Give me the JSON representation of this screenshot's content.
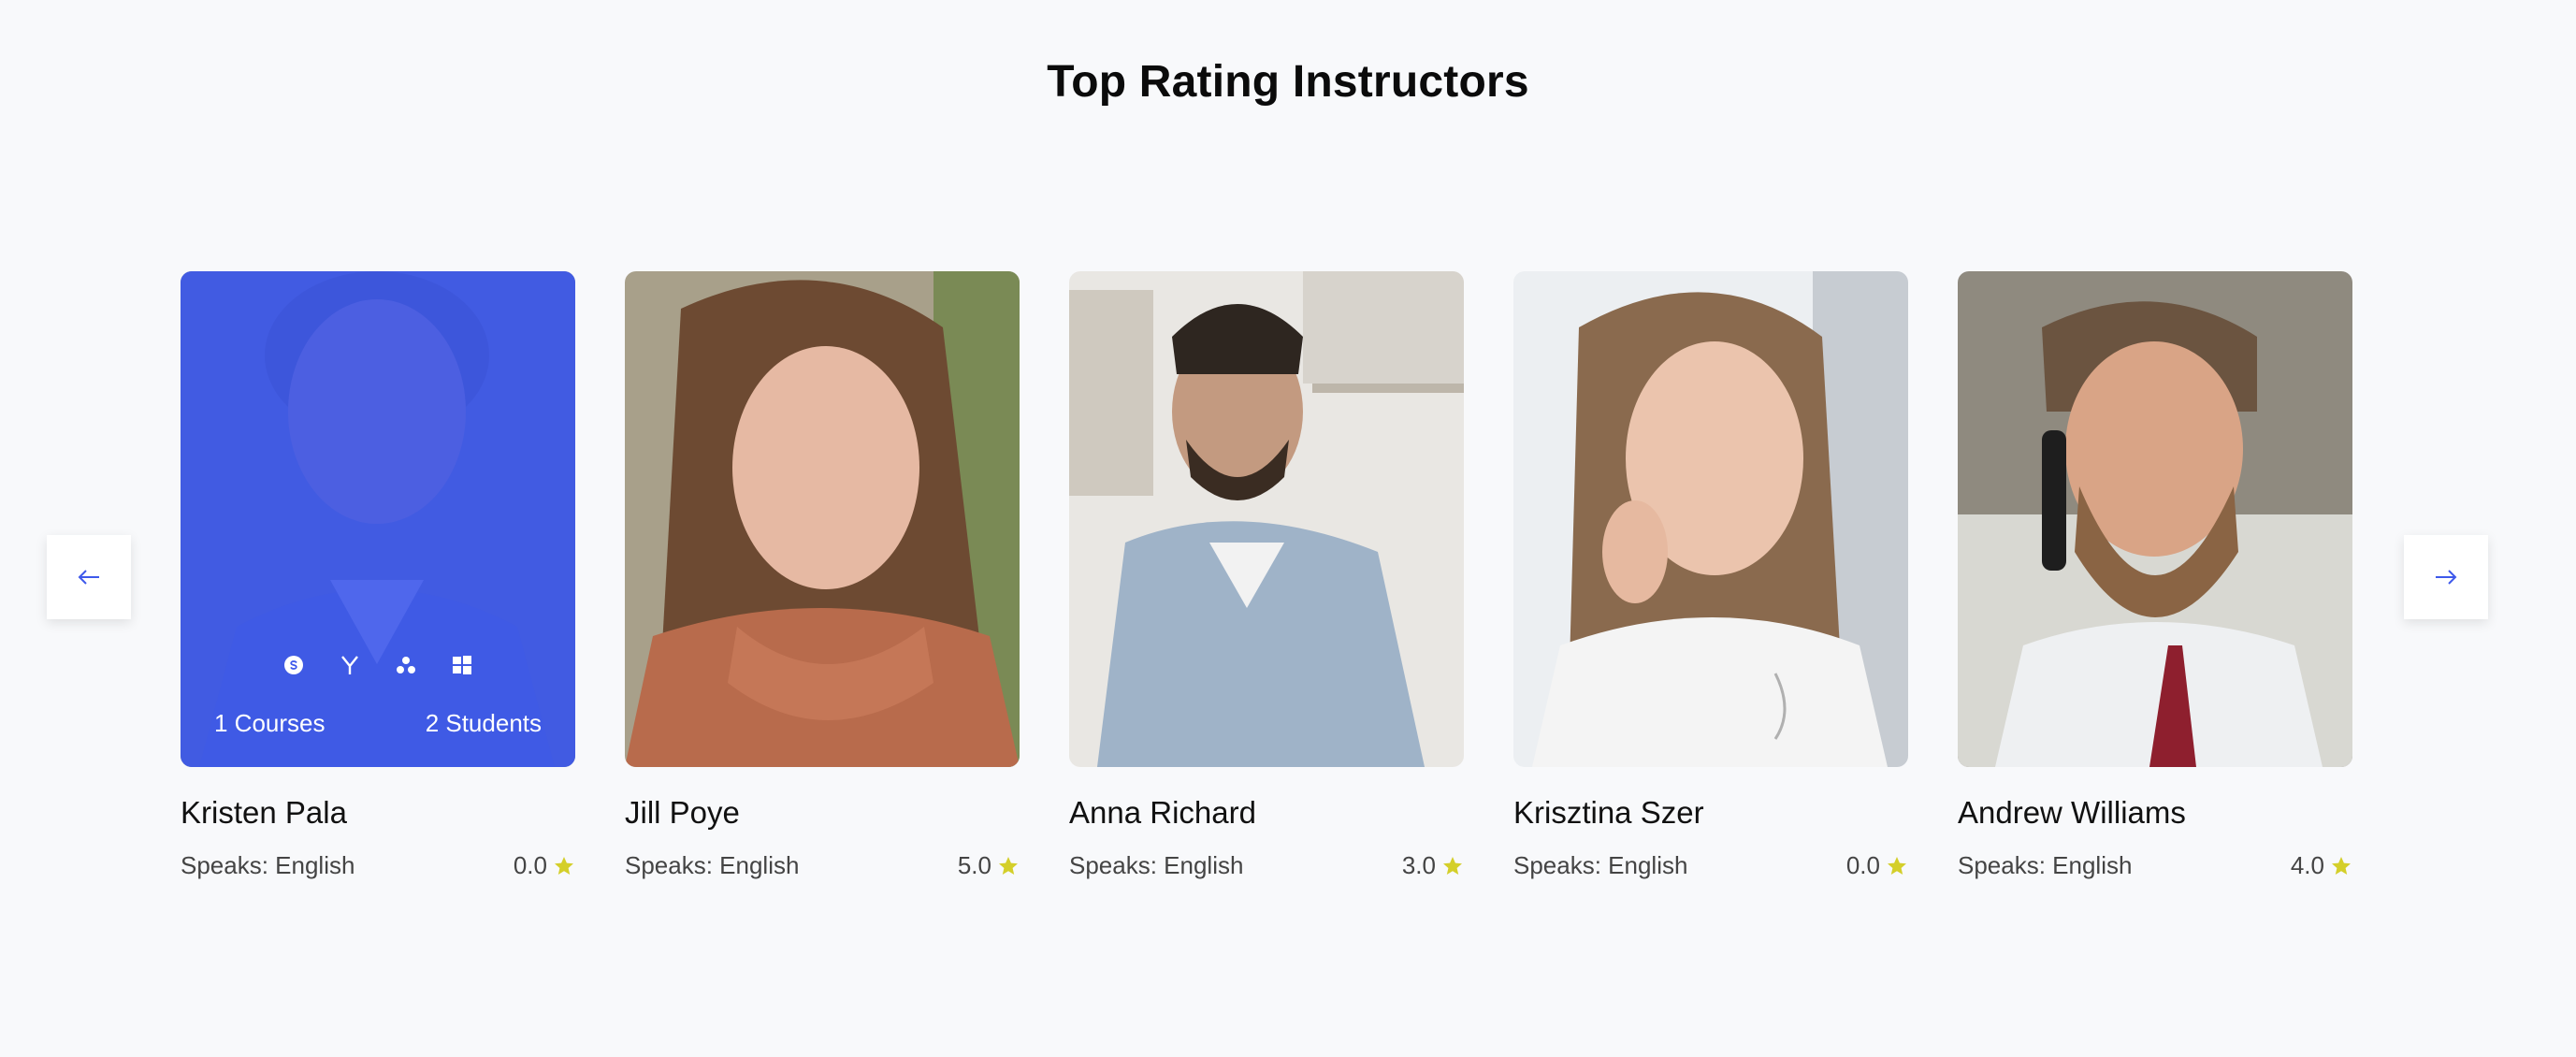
{
  "section": {
    "title": "Top Rating Instructors"
  },
  "carousel": {
    "prev_icon": "arrow-left-icon",
    "next_icon": "arrow-right-icon"
  },
  "colors": {
    "accent": "#3e59eb",
    "star": "#d4cf2a"
  },
  "instructors": [
    {
      "name": "Kristen Pala",
      "speaks": "Speaks: English",
      "rating": "0.0",
      "courses": "1 Courses",
      "students": "2 Students",
      "social_icons": [
        "skype-icon",
        "yahoo-icon",
        "apps-icon",
        "windows-icon"
      ]
    },
    {
      "name": "Jill Poye",
      "speaks": "Speaks: English",
      "rating": "5.0"
    },
    {
      "name": "Anna Richard",
      "speaks": "Speaks: English",
      "rating": "3.0"
    },
    {
      "name": "Krisztina Szer",
      "speaks": "Speaks: English",
      "rating": "0.0"
    },
    {
      "name": "Andrew Williams",
      "speaks": "Speaks: English",
      "rating": "4.0"
    }
  ]
}
